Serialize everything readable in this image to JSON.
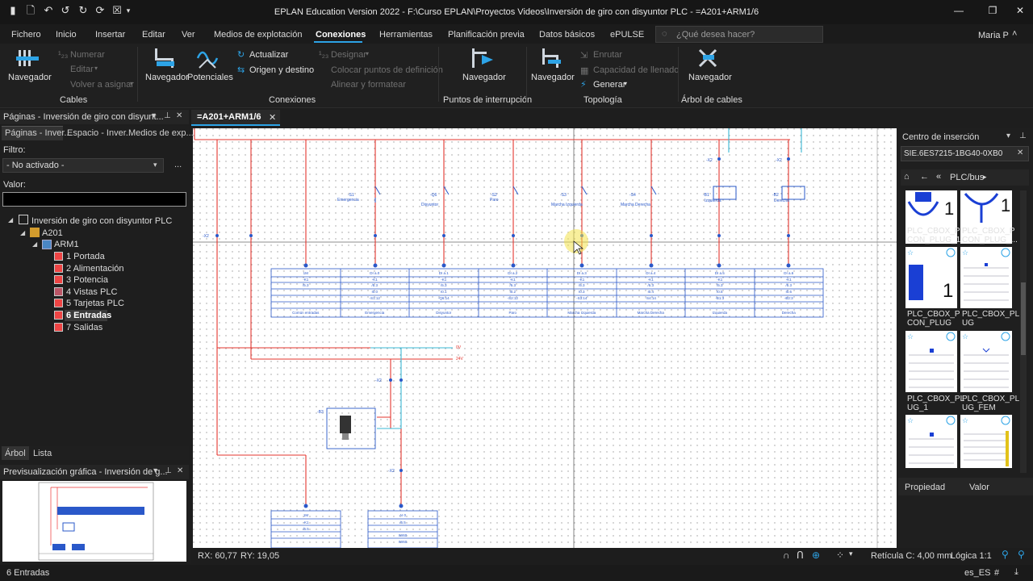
{
  "window": {
    "title": "EPLAN Education Version 2022 - F:\\Curso EPLAN\\Proyectos Videos\\Inversión de giro con disyuntor PLC - =A201+ARM1/6",
    "controls": [
      "minimize-icon",
      "restore-icon",
      "close-icon"
    ]
  },
  "menu": {
    "items": [
      "Fichero",
      "Inicio",
      "Insertar",
      "Editar",
      "Ver",
      "Medios de explotación",
      "Conexiones",
      "Herramientas",
      "Planificación previa",
      "Datos básicos",
      "ePULSE"
    ],
    "active": "Conexiones",
    "search_placeholder": "¿Qué desea hacer?",
    "user": "Maria P"
  },
  "ribbon": {
    "cables": {
      "group_label": "Cables",
      "navigator": "Navegador",
      "numerar": "Numerar",
      "editar": "Editar",
      "volver": "Volver a asignar"
    },
    "conexiones": {
      "group_label": "Conexiones",
      "navigator": "Navegador",
      "potenciales": "Potenciales",
      "actualizar": "Actualizar",
      "origen": "Origen y destino",
      "designar": "Designar",
      "colocar": "Colocar puntos de definición",
      "alinear": "Alinear y formatear"
    },
    "puntos": {
      "group_label": "Puntos de interrupción",
      "navigator": "Navegador"
    },
    "topologia": {
      "group_label": "Topología",
      "navigator": "Navegador",
      "enrutar": "Enrutar",
      "capacidad": "Capacidad de llenado",
      "generar": "Generar"
    },
    "arbol": {
      "group_label": "Árbol de cables",
      "navigator": "Navegador"
    }
  },
  "left_panel": {
    "title": "Páginas - Inversión de giro con disyunt...",
    "tabs": [
      "Páginas - Inver...",
      "Espacio - Inver...",
      "Medios de exp..."
    ],
    "filter_label": "Filtro:",
    "filter_value": "- No activado -",
    "filter_more": "...",
    "value_label": "Valor:",
    "tree": {
      "project": "Inversión de giro con disyuntor PLC",
      "a201": "A201",
      "arm1": "ARM1",
      "pages": [
        "1 Portada",
        "2 Alimentación",
        "3 Potencia",
        "4 Vistas PLC",
        "5 Tarjetas PLC",
        "6 Entradas",
        "7 Salidas"
      ],
      "selected_page": "6 Entradas"
    },
    "bottom_tabs": [
      "Árbol",
      "Lista"
    ],
    "preview_title": "Previsualización gráfica - Inversión de g..."
  },
  "document_tab": {
    "label": "=A201+ARM1/6"
  },
  "schematic": {
    "switches": [
      {
        "tag": "-S1",
        "name": "Emergencia"
      },
      {
        "tag": "-Q6",
        "name": "Disyuntor"
      },
      {
        "tag": "-S2",
        "name": "Paro"
      },
      {
        "tag": "-S3",
        "name": "Marcha Izquierda"
      },
      {
        "tag": "-S4",
        "name": "Marcha Derecha"
      },
      {
        "tag": "-B1",
        "name": "Izquierda"
      },
      {
        "tag": "-B2",
        "name": "Derecha"
      }
    ],
    "terminal_strip": "-X2",
    "plc_columns": [
      {
        "addr": "1M",
        "k": "-K1",
        "a": "/5.3",
        "b": "",
        "c": "",
        "label": "Común entradas"
      },
      {
        "addr": "DI a.0",
        "k": "-K1",
        "a": "/5.3",
        "b": "I0.0",
        "c": "-S1:12",
        "label": "Emergencia"
      },
      {
        "addr": "DI a.1",
        "k": "-K1",
        "a": "/5.3",
        "b": "I0.1",
        "c": "-Q6:14",
        "label": "Disyuntor"
      },
      {
        "addr": "DI a.2",
        "k": "-K1",
        "a": "/5.3",
        "b": "I0.2",
        "c": "-S2:12",
        "label": "Paro"
      },
      {
        "addr": "DI a.3",
        "k": "-K1",
        "a": "/5.3",
        "b": "I0.3",
        "c": "-S3:14",
        "label": "Marcha Izquierda"
      },
      {
        "addr": "DI a.4",
        "k": "-K1",
        "a": "/5.3",
        "b": "I0.4",
        "c": "-S4:14",
        "label": "Marcha Derecha"
      },
      {
        "addr": "DI a.5",
        "k": "-K1",
        "a": "/5.3",
        "b": "I0.5",
        "c": "-B1:3",
        "label": "Izquierda"
      },
      {
        "addr": "DI a.6",
        "k": "-K1",
        "a": "/5.3",
        "b": "I0.6",
        "c": "-B2:3",
        "label": "Derecha"
      }
    ],
    "potentials": [
      "0V",
      "24V"
    ],
    "sensor_tag": "-B3",
    "bottom_blocks": [
      {
        "addr": "1M",
        "k": "-K1",
        "a": "/5.5"
      },
      {
        "addr": "AI 0",
        "k": "/5.5",
        "a": "IW60",
        "b": "IW60"
      }
    ]
  },
  "right_panel": {
    "title": "Centro de inserción",
    "search_value": "SIE.6ES7215-1BG40-0XB0",
    "breadcrumb": "PLC/bus",
    "tiles": [
      {
        "name": "PLC_CBOX_PCON_PLUG_1",
        "caption": "PLC_CBOX_P CON_PLUG_1"
      },
      {
        "name": "PLC_CBOX_PCON_PLUG_2",
        "caption": "PLC_CBOX_P CON_PLUG_..."
      },
      {
        "name": "PLC_CBOX_PCON_PLUG_3",
        "caption": "PLC_CBOX_P CON_PLUG"
      },
      {
        "name": "PLC_CBOX_PLUG",
        "caption": "PLC_CBOX_PL UG"
      },
      {
        "name": "PLC_CBOX_PLUG_1",
        "caption": "PLC_CBOX_PL UG_1"
      },
      {
        "name": "PLC_CBOX_PLUG_FEM",
        "caption": "PLC_CBOX_PL UG_FEM"
      }
    ],
    "prop_header": [
      "Propiedad",
      "Valor"
    ]
  },
  "coords": {
    "rx": "RX: 60,77",
    "ry": "RY: 19,05"
  },
  "status": {
    "page": "6 Entradas",
    "grid": "Retícula C: 4,00 mm",
    "logic": "Lógica 1:1",
    "locale": "es_ES"
  }
}
